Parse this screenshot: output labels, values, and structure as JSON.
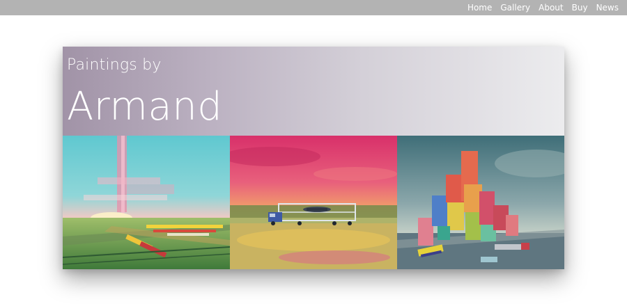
{
  "nav": {
    "items": [
      {
        "label": "Home"
      },
      {
        "label": "Gallery"
      },
      {
        "label": "About"
      },
      {
        "label": "Buy"
      },
      {
        "label": "News"
      }
    ]
  },
  "hero": {
    "subtitle": "Paintings by",
    "title": "Armand"
  },
  "gallery": {
    "paintings": [
      {
        "subject": "rail yard at sunset"
      },
      {
        "subject": "car transporter truck at dusk"
      },
      {
        "subject": "city of shipping containers"
      }
    ]
  }
}
